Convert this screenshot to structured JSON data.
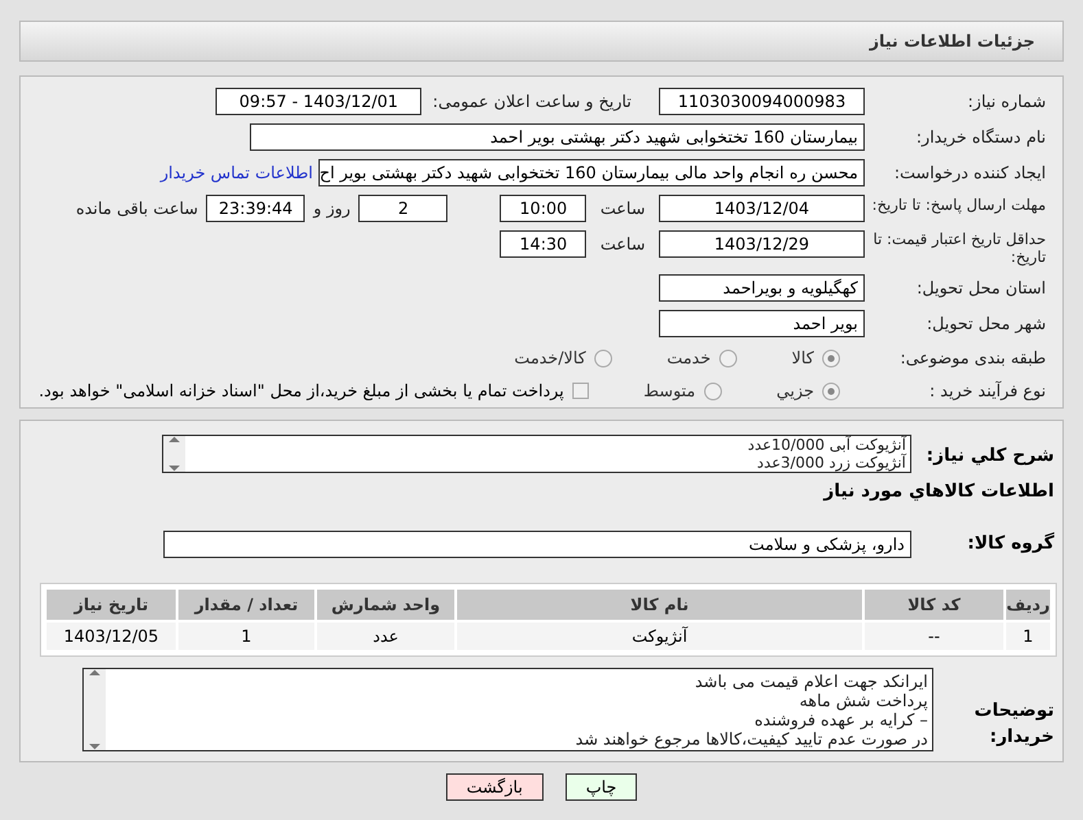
{
  "header": {
    "title": "جزئیات اطلاعات نیاز"
  },
  "need_number": {
    "label": "شماره نیاز:",
    "value": "1103030094000983"
  },
  "announce": {
    "label": "تاریخ و ساعت اعلان عمومی:",
    "value": "1403/12/01 - 09:57"
  },
  "buyer": {
    "label": "نام دستگاه خریدار:",
    "value": "بیمارستان 160 تختخوابی شهید دکتر بهشتی بویر احمد"
  },
  "requester": {
    "label": "ایجاد کننده درخواست:",
    "value": "محسن ره انجام واحد مالی بیمارستان 160 تختخوابی شهید دکتر بهشتی بویر اح",
    "link": "اطلاعات تماس خریدار"
  },
  "reply_deadline": {
    "label": "مهلت ارسال پاسخ: تا تاریخ:",
    "date": "1403/12/04",
    "time_label": "ساعت",
    "time": "10:00",
    "days": "2",
    "days_label": "روز و",
    "remaining": "23:39:44",
    "remaining_label": "ساعت باقی مانده"
  },
  "price_validity": {
    "label": "حداقل تاریخ اعتبار قیمت: تا تاریخ:",
    "date": "1403/12/29",
    "time_label": "ساعت",
    "time": "14:30"
  },
  "province": {
    "label": "استان محل تحویل:",
    "value": "کهگیلویه و بویراحمد"
  },
  "city": {
    "label": "شهر محل تحویل:",
    "value": "بویر احمد"
  },
  "category": {
    "label": "طبقه بندی موضوعی:",
    "options": [
      {
        "label": "کالا",
        "selected": true
      },
      {
        "label": "خدمت",
        "selected": false
      },
      {
        "label": "کالا/خدمت",
        "selected": false
      }
    ]
  },
  "process": {
    "label": "نوع فرآیند خرید :",
    "options": [
      {
        "label": "جزیي",
        "selected": true
      },
      {
        "label": "متوسط",
        "selected": false
      }
    ],
    "checkbox": {
      "label": "پرداخت تمام یا بخشی از مبلغ خرید،از محل \"اسناد خزانه اسلامی\" خواهد بود.",
      "checked": false
    }
  },
  "description": {
    "label": "شرح کلي نياز:",
    "lines": [
      "آنژیوکت آبی 10/000عدد",
      "آنژیوکت زرد 3/000عدد"
    ]
  },
  "goods_title": "اطلاعات کالاهاي مورد نياز",
  "goods_group": {
    "label": "گروه کالا:",
    "value": "دارو، پزشکی و سلامت"
  },
  "table": {
    "columns": [
      "ردیف",
      "کد کالا",
      "نام کالا",
      "واحد شمارش",
      "تعداد / مقدار",
      "تاریخ نیاز"
    ],
    "rows": [
      [
        "1",
        "--",
        "آنژیوکت",
        "عدد",
        "1",
        "1403/12/05"
      ]
    ]
  },
  "buyer_notes": {
    "label": "توضیحات خریدار:",
    "lines": [
      "ایرانکد جهت اعلام قیمت می باشد",
      "پرداخت شش ماهه",
      "– کرایه بر عهده فروشنده",
      "در صورت عدم تایید کیفیت،کالاها مرجوع خواهند شد"
    ]
  },
  "buttons": [
    {
      "label": "چاپ",
      "kind": "print"
    },
    {
      "label": "بازگشت",
      "kind": "back"
    }
  ]
}
